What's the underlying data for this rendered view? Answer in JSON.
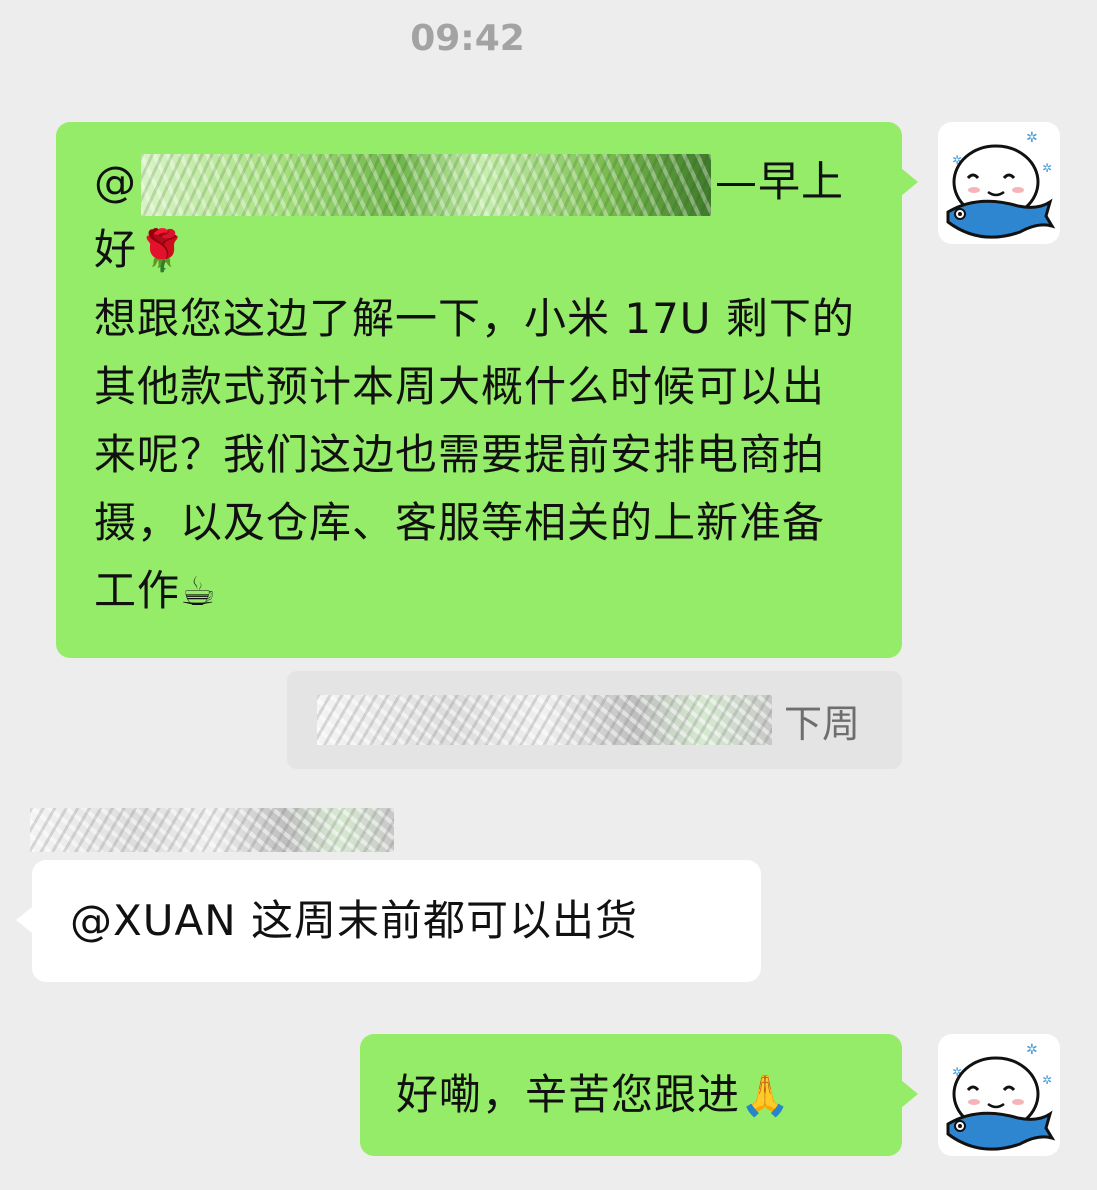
{
  "status": {
    "time": "09:42"
  },
  "messages": [
    {
      "side": "right",
      "mention_prefix": "@",
      "line1_suffix": "—早上",
      "line2_text": "好",
      "line2_emoji": "🌹",
      "body": "想跟您这边了解一下，小米 17U 剩下的其他款式预计本周大概什么时候可以出来呢？我们这边也需要提前安排电商拍摄，以及仓库、客服等相关的上新准备工作",
      "body_emoji": "☕"
    },
    {
      "side": "right-quote",
      "quote_suffix": "下周"
    },
    {
      "side": "left",
      "text": "@XUAN 这周末前都可以出货"
    },
    {
      "side": "right",
      "text": "好嘞，辛苦您跟进",
      "emoji": "🙏"
    }
  ],
  "icons": {
    "avatar": "cartoon-avatar-icon",
    "rose": "rose-icon",
    "coffee": "coffee-icon",
    "pray": "pray-icon"
  },
  "colors": {
    "background": "#ededed",
    "sent_bubble": "#95ec69",
    "received_bubble": "#ffffff",
    "quote_bubble": "#e4e4e4",
    "timestamp": "#a3a3a3"
  }
}
